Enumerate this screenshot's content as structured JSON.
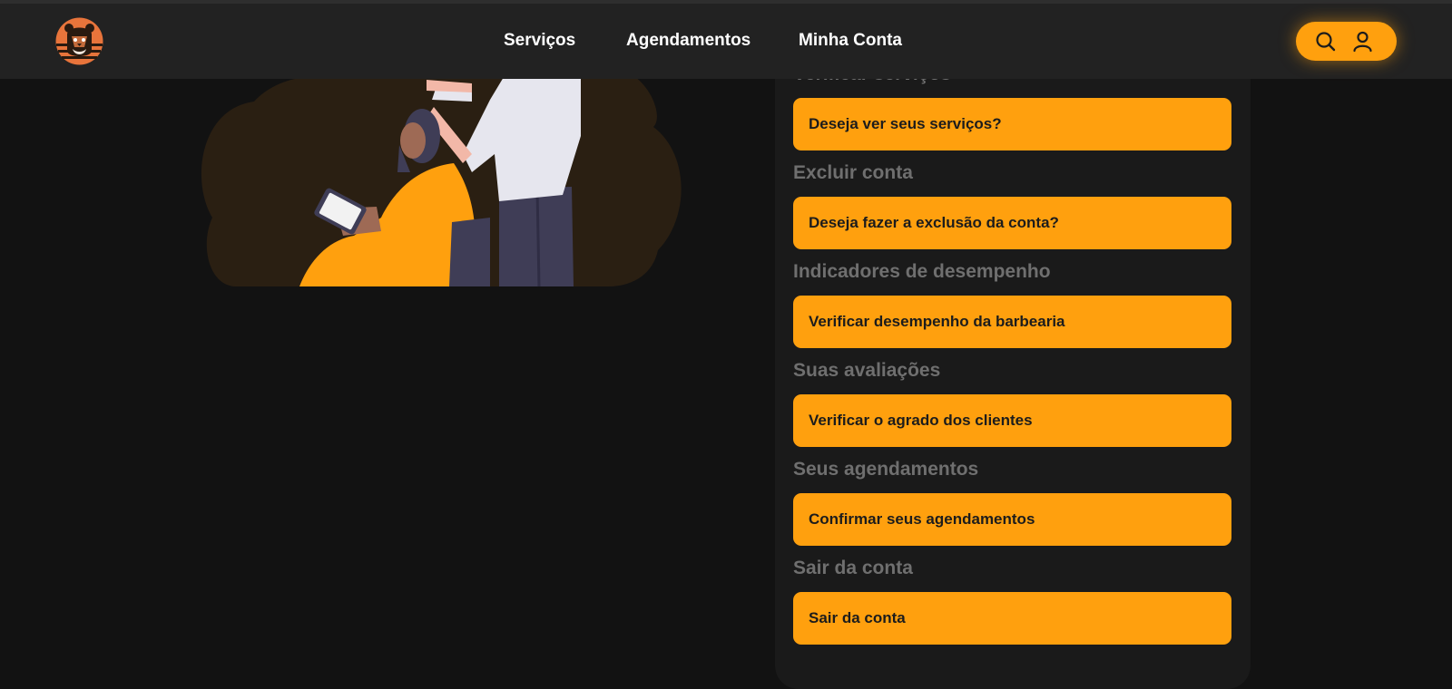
{
  "nav": {
    "items": [
      {
        "label": "Serviços"
      },
      {
        "label": "Agendamentos"
      },
      {
        "label": "Minha Conta"
      }
    ],
    "logo_icon": "bear-barber-logo",
    "search_icon": "search-icon",
    "user_icon": "user-icon"
  },
  "sections": [
    {
      "title": "Verificar serviços",
      "button": "Deseja ver seus serviços?"
    },
    {
      "title": "Excluir conta",
      "button": "Deseja fazer a exclusão da conta?"
    },
    {
      "title": "Indicadores de desempenho",
      "button": "Verificar desempenho da barbearia"
    },
    {
      "title": "Suas avaliações",
      "button": "Verificar o agrado dos clientes"
    },
    {
      "title": "Seus agendamentos",
      "button": "Confirmar seus agendamentos"
    },
    {
      "title": "Sair da conta",
      "button": "Sair da conta"
    }
  ],
  "colors": {
    "accent": "#ffa00e",
    "background": "#121212",
    "header": "#222222",
    "panel": "#1a1a1a",
    "section_title": "#6f6f6f"
  }
}
